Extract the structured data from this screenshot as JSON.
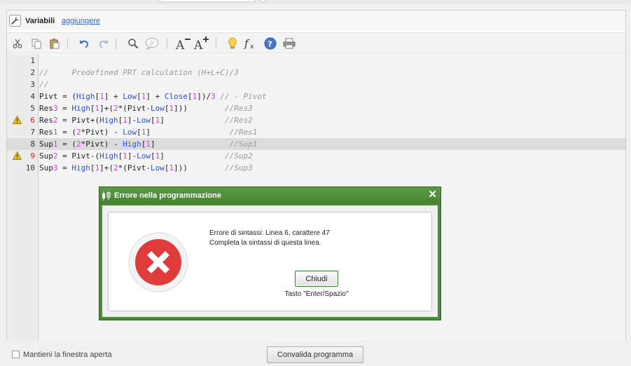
{
  "window": {
    "title": "Variabili",
    "add_link": "aggiungere"
  },
  "toolbar": {
    "icons": [
      "cut-icon",
      "copy-icon",
      "paste-icon",
      "undo-icon",
      "redo-icon",
      "search-icon",
      "comment-icon",
      "font-smaller-icon",
      "font-larger-icon",
      "lightbulb-icon",
      "function-icon",
      "help-icon",
      "print-icon"
    ]
  },
  "editor": {
    "lines": [
      {
        "n": "1",
        "text": ""
      },
      {
        "n": "2",
        "text": "//     Predefined PRT calculation (H+L+C)/3"
      },
      {
        "n": "3",
        "text": "//"
      },
      {
        "n": "4",
        "text": "Pivt = (High[1] + Low[1] + Close[1])/3 // - Pivot"
      },
      {
        "n": "5",
        "text": "Res3 = High[1]+(2*(Pivt-Low[1]))        //Res3"
      },
      {
        "n": "6",
        "text": "Res2 = Pivt+(High[1]-Low[1]             //Res2"
      },
      {
        "n": "7",
        "text": "Res1 = (2*Pivt) - Low[1]                 //Res1"
      },
      {
        "n": "8",
        "text": "Sup1 = (2*Pivt) - High[1]                //Sup1"
      },
      {
        "n": "9",
        "text": "Sup2 = Pivt-(High[1]-Low[1]             //Sup2"
      },
      {
        "n": "10",
        "text": "Sup3 = High[1]+(2*(Pivt-Low[1]))        //Sup3"
      }
    ],
    "warning_lines": [
      "6",
      "9"
    ],
    "highlighted_line": "8"
  },
  "dialog": {
    "title": "Errore nella programmazione",
    "close_symbol": "✕",
    "message_line1": "Errore di sintassi: Linea 6, carattere 47",
    "message_line2": "Completa la sintassi di questa linea.",
    "button_label": "Chiudi",
    "shortcut_hint": "Tasto \"Enter/Spazio\"",
    "accent_color": "#4e8a3c",
    "error_color": "#e03b3b"
  },
  "footer": {
    "keep_open_label": "Mantieni la finestra aperta",
    "keep_open_checked": false,
    "validate_label": "Convalida programma"
  }
}
